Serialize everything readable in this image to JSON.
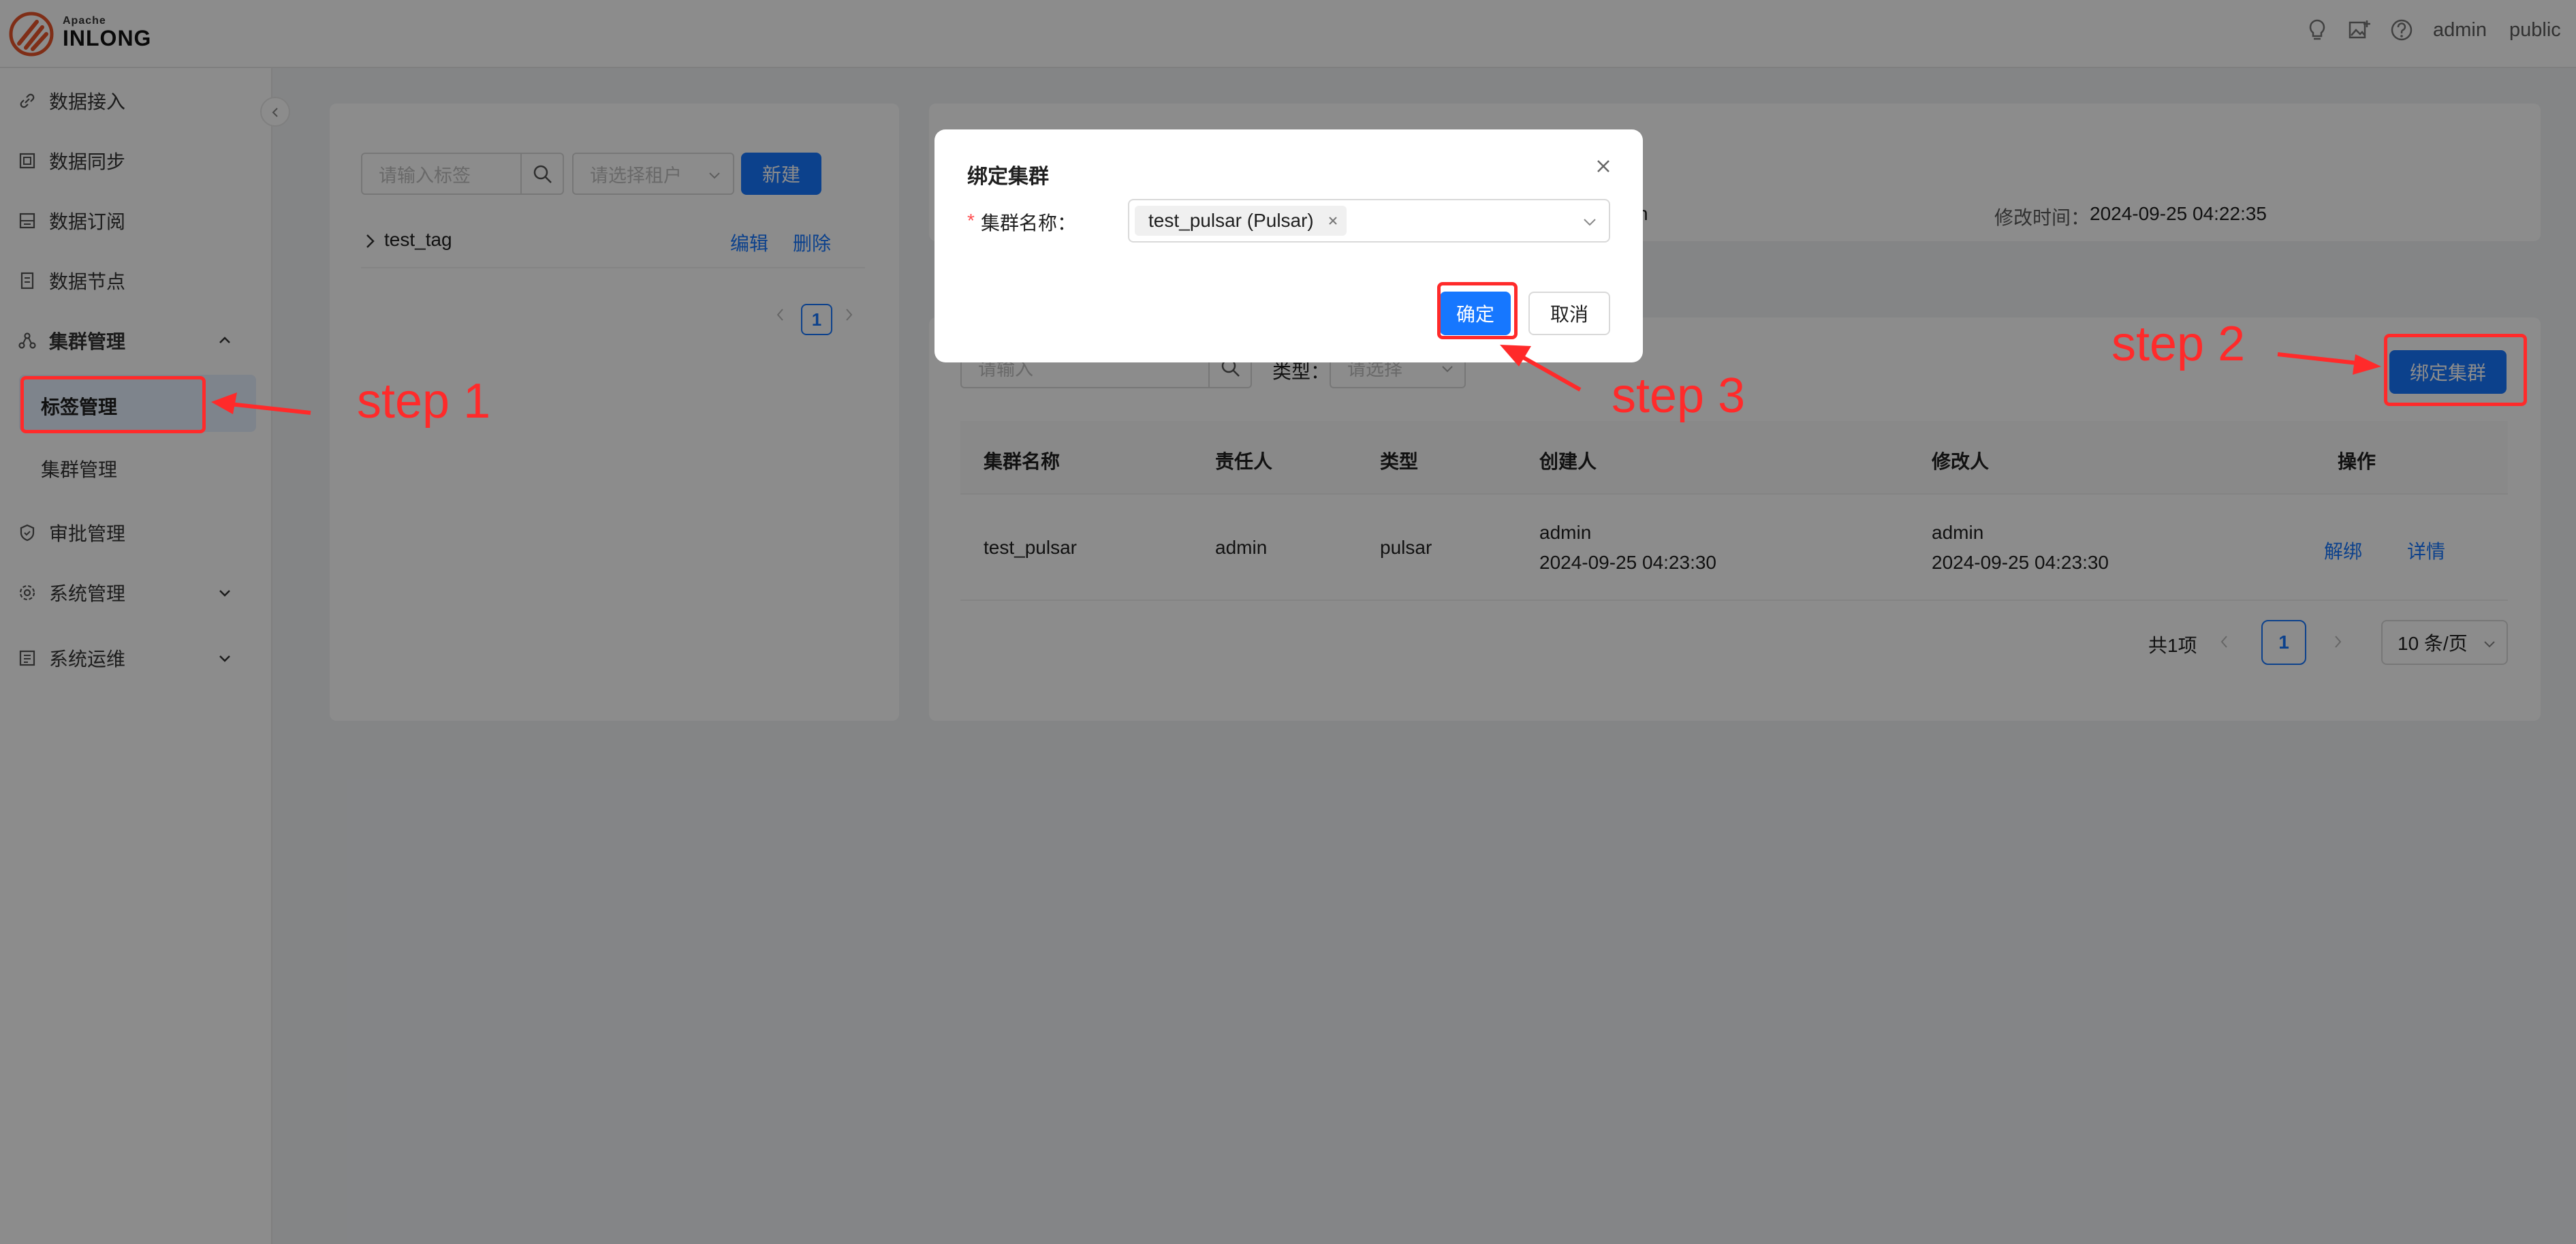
{
  "header": {
    "logo_small": "Apache",
    "logo_big": "INLONG",
    "user": "admin",
    "tenant": "public"
  },
  "sidebar": {
    "items": [
      {
        "label": "数据接入"
      },
      {
        "label": "数据同步"
      },
      {
        "label": "数据订阅"
      },
      {
        "label": "数据节点"
      },
      {
        "label": "集群管理"
      },
      {
        "label": "审批管理"
      },
      {
        "label": "系统管理"
      },
      {
        "label": "系统运维"
      }
    ],
    "sub_items": [
      {
        "label": "标签管理"
      },
      {
        "label": "集群管理"
      }
    ]
  },
  "tag_panel": {
    "search_placeholder": "请输入标签",
    "tenant_placeholder": "请选择租户",
    "new_button": "新建",
    "tag": {
      "name": "test_tag",
      "edit": "编辑",
      "delete": "删除"
    },
    "page": "1"
  },
  "detail_panel": {
    "partial_text": "n",
    "modified_label": "修改时间：",
    "modified_value": "2024-09-25 04:22:35"
  },
  "cluster_panel": {
    "search_placeholder": "请输入",
    "type_label": "类型：",
    "type_placeholder": "请选择",
    "bind_button": "绑定集群",
    "columns": [
      "集群名称",
      "责任人",
      "类型",
      "创建人",
      "修改人",
      "操作"
    ],
    "row": {
      "name": "test_pulsar",
      "owner": "admin",
      "type": "pulsar",
      "creator": "admin",
      "created": "2024-09-25 04:23:30",
      "modifier": "admin",
      "modified": "2024-09-25 04:23:30",
      "unbind": "解绑",
      "detail": "详情"
    },
    "total": "共1项",
    "page": "1",
    "page_size": "10 条/页"
  },
  "modal": {
    "title": "绑定集群",
    "required_mark": "*",
    "field_label": "集群名称：",
    "selected_tag": "test_pulsar (Pulsar)",
    "ok_button": "确定",
    "cancel_button": "取消"
  },
  "annotations": {
    "step1": "step 1",
    "step2": "step 2",
    "step3": "step 3"
  },
  "colors": {
    "primary": "#1677ff",
    "annotation_red": "#ff2a2a",
    "logo_orange": "#e8542b"
  }
}
